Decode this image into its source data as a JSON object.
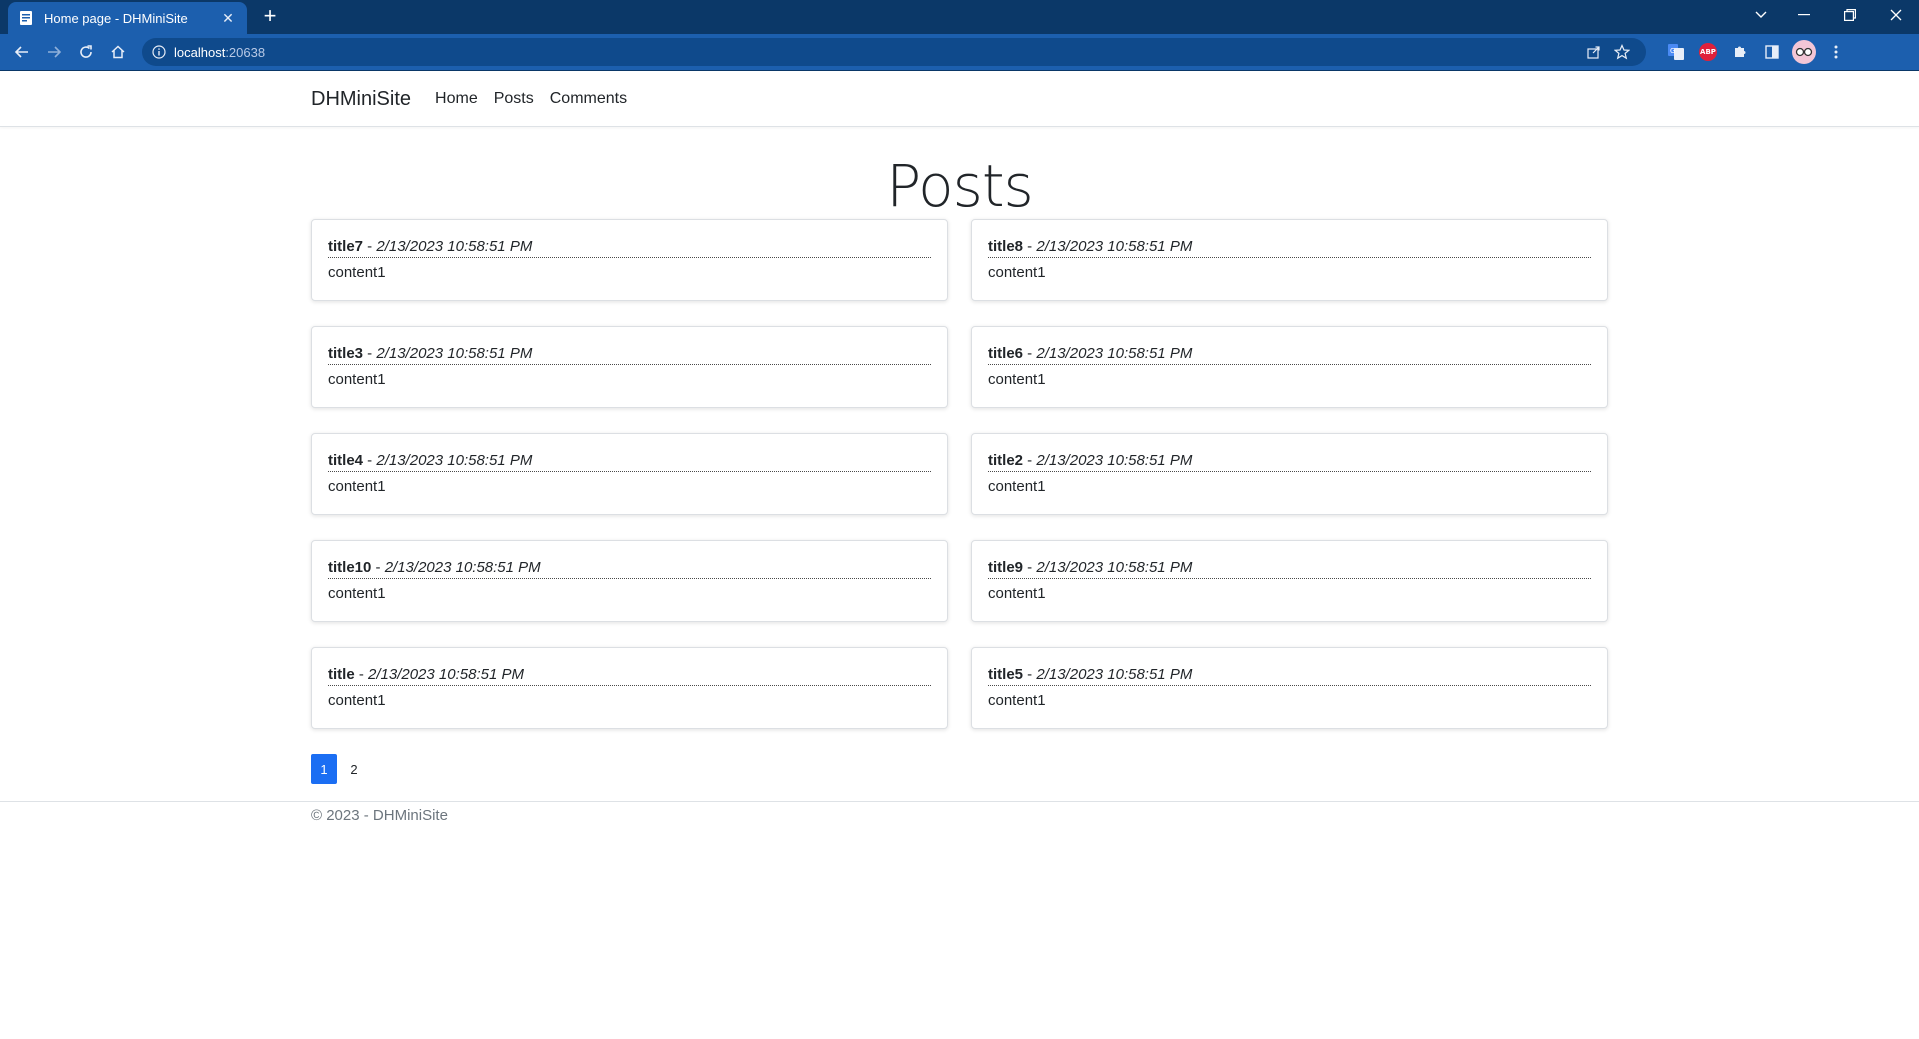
{
  "browser": {
    "tab_title": "Home page - DHMiniSite",
    "tab_close": "✕",
    "new_tab": "+",
    "url_host": "localhost",
    "url_port": ":20638",
    "abp_label": "ABP",
    "colors": {
      "tabbar": "#0b3868",
      "toolbar": "#1c5fae"
    }
  },
  "site": {
    "brand": "DHMiniSite",
    "nav": [
      "Home",
      "Posts",
      "Comments"
    ]
  },
  "page": {
    "title": "Posts",
    "separator": " - ",
    "posts": [
      {
        "title": "title7",
        "date": "2/13/2023 10:58:51 PM",
        "content": "content1"
      },
      {
        "title": "title8",
        "date": "2/13/2023 10:58:51 PM",
        "content": "content1"
      },
      {
        "title": "title3",
        "date": "2/13/2023 10:58:51 PM",
        "content": "content1"
      },
      {
        "title": "title6",
        "date": "2/13/2023 10:58:51 PM",
        "content": "content1"
      },
      {
        "title": "title4",
        "date": "2/13/2023 10:58:51 PM",
        "content": "content1"
      },
      {
        "title": "title2",
        "date": "2/13/2023 10:58:51 PM",
        "content": "content1"
      },
      {
        "title": "title10",
        "date": "2/13/2023 10:58:51 PM",
        "content": "content1"
      },
      {
        "title": "title9",
        "date": "2/13/2023 10:58:51 PM",
        "content": "content1"
      },
      {
        "title": "title",
        "date": "2/13/2023 10:58:51 PM",
        "content": "content1"
      },
      {
        "title": "title5",
        "date": "2/13/2023 10:58:51 PM",
        "content": "content1"
      }
    ],
    "pagination": {
      "pages": [
        "1",
        "2"
      ],
      "current": "1"
    }
  },
  "footer": {
    "text": "© 2023 - DHMiniSite"
  }
}
